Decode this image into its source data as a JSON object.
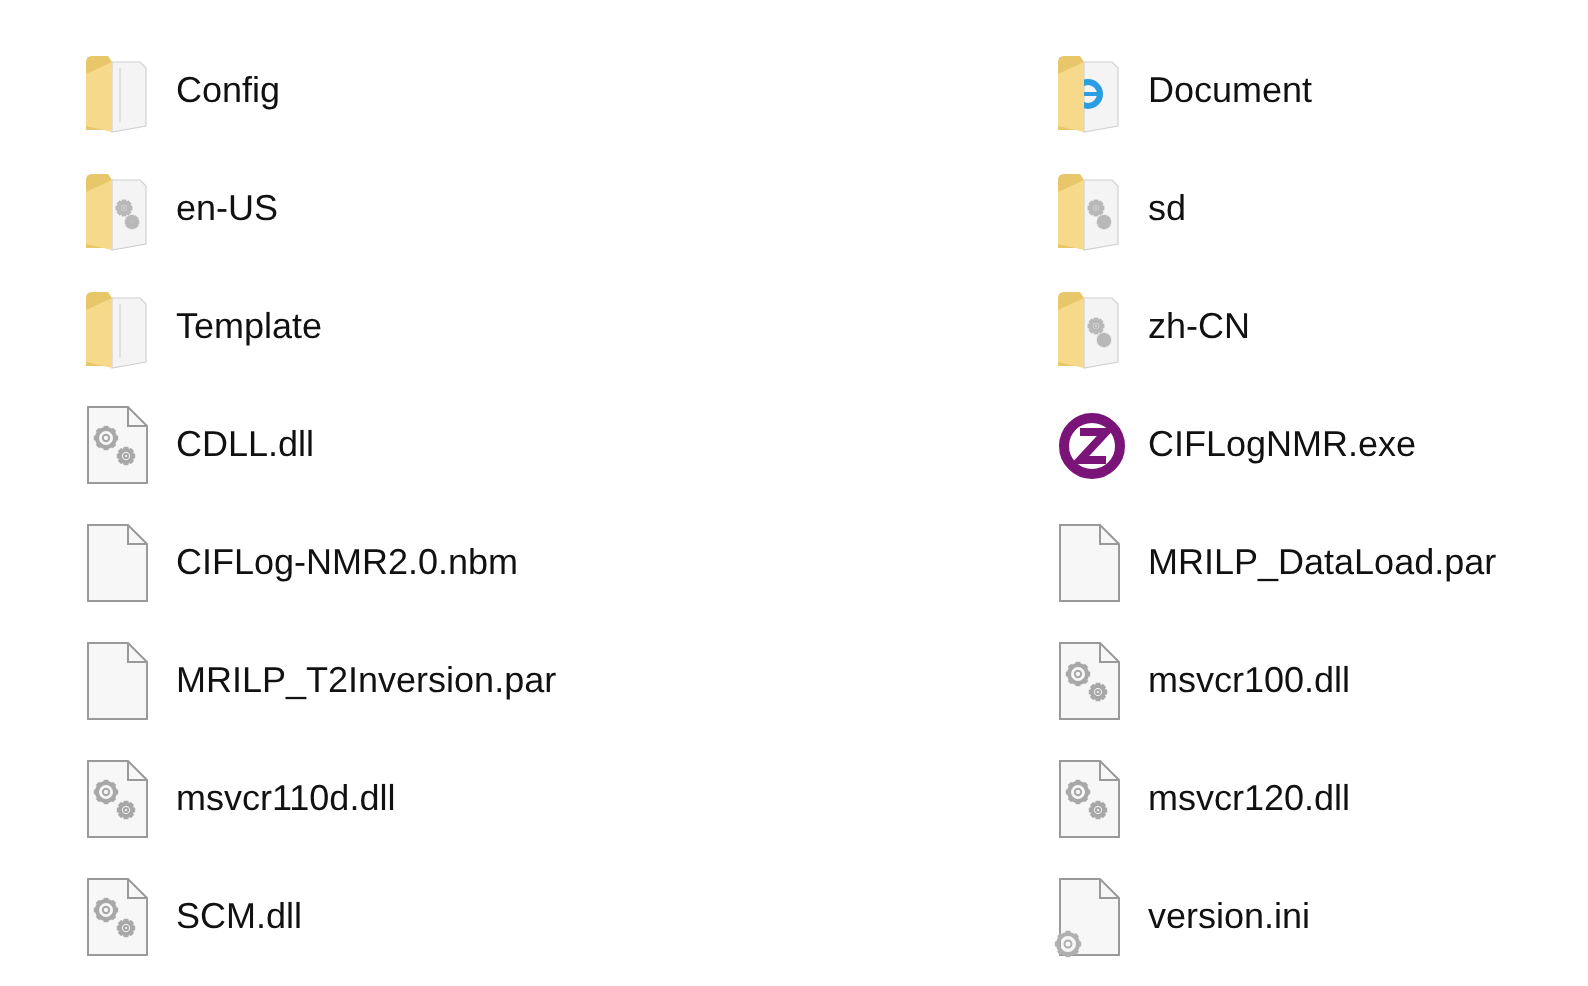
{
  "files": [
    {
      "name": "Config",
      "kind": "folder"
    },
    {
      "name": "Document",
      "kind": "folder-web"
    },
    {
      "name": "en-US",
      "kind": "folder-settings"
    },
    {
      "name": "sd",
      "kind": "folder-settings"
    },
    {
      "name": "Template",
      "kind": "folder"
    },
    {
      "name": "zh-CN",
      "kind": "folder-settings"
    },
    {
      "name": "CDLL.dll",
      "kind": "settings-file"
    },
    {
      "name": "CIFLogNMR.exe",
      "kind": "app"
    },
    {
      "name": "CIFLog-NMR2.0.nbm",
      "kind": "blank-file"
    },
    {
      "name": "MRILP_DataLoad.par",
      "kind": "blank-file"
    },
    {
      "name": "MRILP_T2Inversion.par",
      "kind": "blank-file"
    },
    {
      "name": "msvcr100.dll",
      "kind": "settings-file"
    },
    {
      "name": "msvcr110d.dll",
      "kind": "settings-file"
    },
    {
      "name": "msvcr120.dll",
      "kind": "settings-file"
    },
    {
      "name": "SCM.dll",
      "kind": "settings-file"
    },
    {
      "name": "version.ini",
      "kind": "config-file"
    }
  ]
}
